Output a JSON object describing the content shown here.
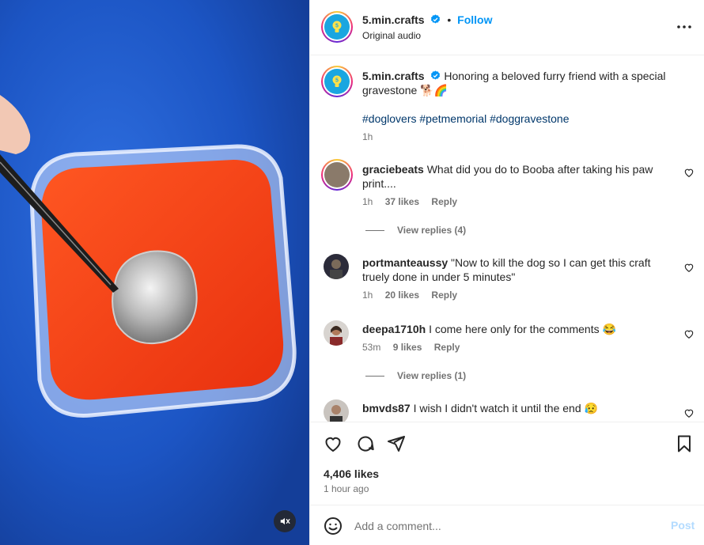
{
  "post": {
    "username": "5.min.crafts",
    "follow_label": "Follow",
    "audio_label": "Original audio",
    "caption_text": "Honoring a beloved furry friend with a special gravestone 🐕🌈",
    "hashtags": "#doglovers #petmemorial #doggravestone",
    "caption_time": "1h",
    "likes": "4,406 likes",
    "posted_ago": "1 hour ago"
  },
  "comments": [
    {
      "username": "graciebeats",
      "text": "What did you do to Booba after taking his paw print....",
      "time": "1h",
      "likes": "37 likes",
      "reply_label": "Reply",
      "view_replies": "View replies (4)"
    },
    {
      "username": "portmanteaussy",
      "text": "\"Now to kill the dog so I can get this craft truely done in under 5 minutes\"",
      "time": "1h",
      "likes": "20 likes",
      "reply_label": "Reply"
    },
    {
      "username": "deepa1710h",
      "text": "I come here only for the comments 😂",
      "time": "53m",
      "likes": "9 likes",
      "reply_label": "Reply",
      "view_replies": "View replies (1)"
    },
    {
      "username": "bmvds87",
      "text": "I wish I didn't watch it until the end 😥"
    }
  ],
  "composer": {
    "placeholder": "Add a comment...",
    "post_label": "Post"
  },
  "colors": {
    "accent": "#0095f6",
    "post_disabled": "#b3dbff",
    "media_background": "#1a4fb8",
    "sand": "#f03a16"
  },
  "icons": [
    "more-options-icon",
    "verified-badge-icon",
    "heart-icon",
    "comment-icon",
    "share-icon",
    "bookmark-icon",
    "emoji-icon",
    "mute-icon"
  ]
}
